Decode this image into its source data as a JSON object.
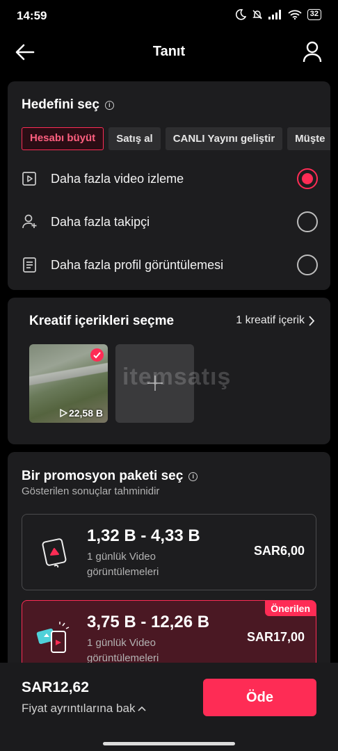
{
  "status_bar": {
    "time": "14:59",
    "battery": "32"
  },
  "nav": {
    "title": "Tanıt"
  },
  "goal": {
    "title": "Hedefini seç",
    "chips": [
      {
        "label": "Hesabı büyüt",
        "active": true
      },
      {
        "label": "Satış al",
        "active": false
      },
      {
        "label": "CANLI Yayını geliştir",
        "active": false
      },
      {
        "label": "Müşte",
        "active": false
      }
    ],
    "options": [
      {
        "label": "Daha fazla video izleme",
        "icon": "video-play-icon",
        "selected": true
      },
      {
        "label": "Daha fazla takipçi",
        "icon": "add-user-icon",
        "selected": false
      },
      {
        "label": "Daha fazla profil görüntülemesi",
        "icon": "profile-card-icon",
        "selected": false
      }
    ]
  },
  "creative": {
    "title": "Kreatif içerikleri seçme",
    "link_label": "1 kreatif içerik",
    "thumb_views": "22,58 B",
    "watermark": "itemsatış"
  },
  "package": {
    "title": "Bir promosyon paketi seç",
    "subtitle": "Gösterilen sonuçlar tahminidir",
    "items": [
      {
        "range": "1,32 B - 4,33 B",
        "desc": "1 günlük Video görüntülemeleri",
        "price": "SAR6,00",
        "badge": ""
      },
      {
        "range": "3,75 B - 12,26 B",
        "desc": "1 günlük Video görüntülemeleri",
        "price": "SAR17,00",
        "badge": "Önerilen"
      }
    ]
  },
  "footer": {
    "total": "SAR12,62",
    "details_label": "Fiyat ayrıntılarına bak",
    "pay_label": "Öde"
  },
  "colors": {
    "accent": "#fe2c55",
    "card": "#1d1d1f",
    "background": "#000000"
  }
}
